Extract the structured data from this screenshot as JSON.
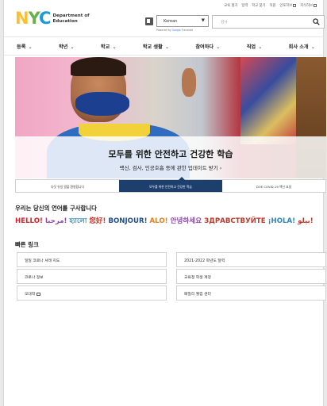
{
  "utility_links": [
    {
      "label": "교육 평가",
      "external": false
    },
    {
      "label": "달력",
      "external": false
    },
    {
      "label": "학교 찾기",
      "external": false
    },
    {
      "label": "직원",
      "external": false
    },
    {
      "label": "인포허브",
      "external": true
    },
    {
      "label": "지식허브",
      "external": true
    }
  ],
  "header": {
    "logo_mark": "NYC",
    "logo_text_line1": "Department of",
    "logo_text_line2": "Education",
    "language_select_value": "Korean",
    "powered_by_prefix": "Powered by",
    "powered_by_brand": "Google",
    "powered_by_suffix": "Translate",
    "search_placeholder": "검사"
  },
  "nav": [
    {
      "label": "등록",
      "caret": "⌄"
    },
    {
      "label": "학년",
      "caret": "⌄"
    },
    {
      "label": "학교",
      "caret": "⌄"
    },
    {
      "label": "학교 생활",
      "caret": "⌄"
    },
    {
      "label": "참여하다",
      "caret": "⌄"
    },
    {
      "label": "직업",
      "caret": "⌄"
    },
    {
      "label": "회사 소개",
      "caret": "⌄"
    }
  ],
  "hero": {
    "title": "모두를 위한 안전하고 건강한 학습",
    "subtitle": "백신, 검사, 인공호흡 등에 관한 업데이트 받기",
    "subtitle_arrow": "›"
  },
  "carousel_tabs": [
    {
      "label": "다섯 유일 얼을 환영합니다",
      "active": false
    },
    {
      "label": "모두를 위한 안전하고 건강한 학습",
      "active": true
    },
    {
      "label": "DOE COVID-19 백신 요일",
      "active": false
    }
  ],
  "languages_heading": "우리는 당신의 언어를 구사합니다",
  "greetings": [
    {
      "text": "HELLO!",
      "color": "#d2232a"
    },
    {
      "text": "مرحبا!",
      "color": "#8e44ad"
    },
    {
      "text": "হ্যালো",
      "color": "#2e86c1"
    },
    {
      "text": "您好!",
      "color": "#c0392b"
    },
    {
      "text": "BONJOUR!",
      "color": "#1f4f8f"
    },
    {
      "text": "ALO!",
      "color": "#e67e22"
    },
    {
      "text": "안녕하세요",
      "color": "#8e44ad"
    },
    {
      "text": "ЗДРАВСТВУЙТЕ",
      "color": "#c0392b"
    },
    {
      "text": "¡HOLA!",
      "color": "#2e86c1"
    },
    {
      "text": "بيلو!",
      "color": "#c0392b"
    }
  ],
  "quick_links_heading": "빠른 링크",
  "quick_links_left": [
    {
      "label": "일일 코로나 셔레 지도",
      "external": false
    },
    {
      "label": "코로나 정보",
      "external": false
    },
    {
      "label": "모대학",
      "external": true
    }
  ],
  "quick_links_right": [
    {
      "label": "2021-2022 학년도 달력",
      "external": false
    },
    {
      "label": "교육청 학생 계정",
      "external": false
    },
    {
      "label": "패밀리 웰컴 센터",
      "external": false
    }
  ],
  "colors": {
    "active_tab": "#1c3f6e",
    "logo_yellow": "#fdbf2d",
    "logo_green": "#6ab04c",
    "logo_blue": "#1e9ad6"
  }
}
